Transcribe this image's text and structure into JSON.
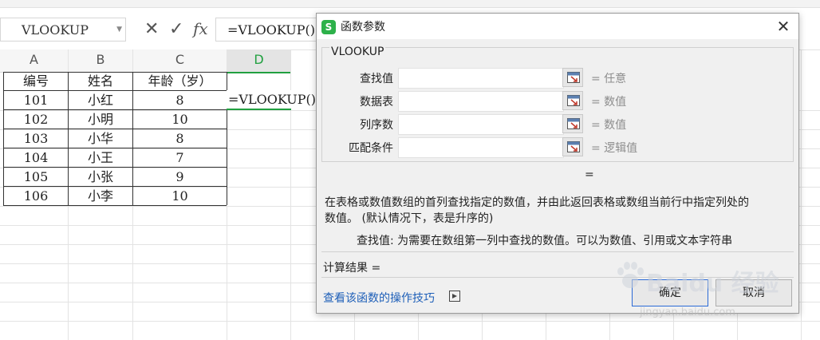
{
  "formula_bar": {
    "name_box": "VLOOKUP",
    "cancel_icon": "✕",
    "confirm_icon": "✓",
    "fx_label": "fx",
    "formula": "=VLOOKUP()"
  },
  "sheet": {
    "columns": [
      "A",
      "B",
      "C",
      "D"
    ],
    "header_row": [
      "编号",
      "姓名",
      "年龄（岁）"
    ],
    "rows": [
      [
        "101",
        "小红",
        "8"
      ],
      [
        "102",
        "小明",
        "10"
      ],
      [
        "103",
        "小华",
        "8"
      ],
      [
        "104",
        "小王",
        "7"
      ],
      [
        "105",
        "小张",
        "9"
      ],
      [
        "106",
        "小李",
        "10"
      ]
    ],
    "active_cell_text": "=VLOOKUP()"
  },
  "dialog": {
    "title": "函数参数",
    "logo": "S",
    "close": "✕",
    "function_name": "VLOOKUP",
    "args": [
      {
        "label": "查找值",
        "value": "= 任意"
      },
      {
        "label": "数据表",
        "value": "= 数值"
      },
      {
        "label": "列序数",
        "value": "= 数值"
      },
      {
        "label": "匹配条件",
        "value": "= 逻辑值"
      }
    ],
    "result_eq": "=",
    "description_line1": "在表格或数值数组的首列查找指定的数值，并由此返回表格或数组当前行中指定列处的",
    "description_line2": "数值。 (默认情况下，表是升序的)",
    "arg_help": "查找值:  为需要在数组第一列中查找的数值。可以为数值、引用或文本字符串",
    "calc_result": "计算结果 =",
    "help_link": "查看该函数的操作技巧",
    "ok": "确定",
    "cancel": "取消"
  },
  "watermark": {
    "text": "Baidu 经验",
    "sub": "jingyan.baidu.com"
  }
}
